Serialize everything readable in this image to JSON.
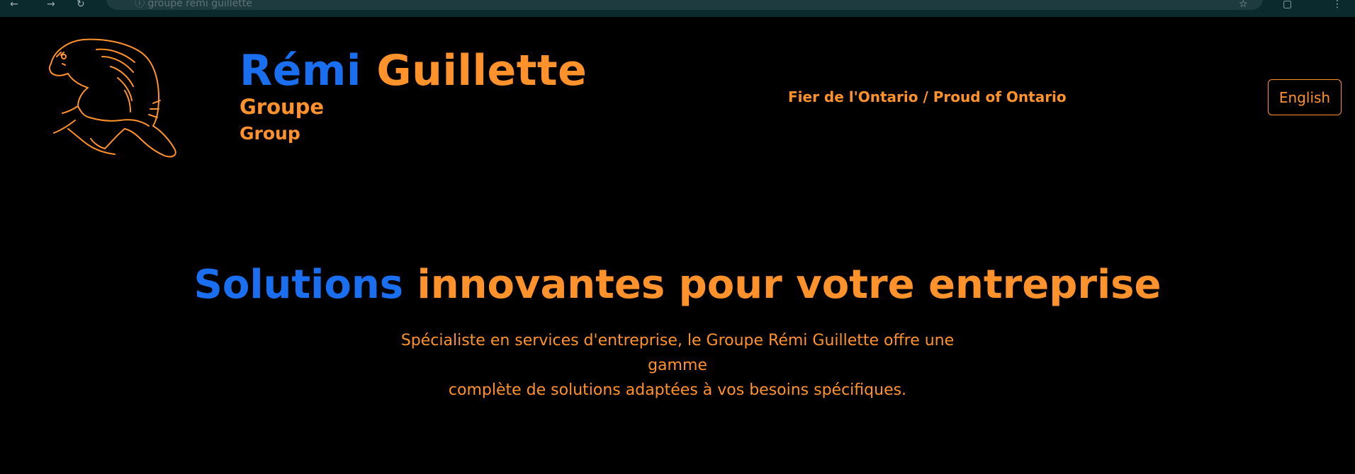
{
  "browser": {
    "url_text": "ⓘ groupe remi guillette"
  },
  "header": {
    "brand_first": "Rémi",
    "brand_last": "Guillette",
    "brand_sub_fr": "Groupe",
    "brand_sub_en": "Group",
    "tagline": "Fier de l'Ontario / Proud of Ontario",
    "language_button": "English"
  },
  "hero": {
    "title_highlight": "Solutions",
    "title_rest": "innovantes pour votre entreprise",
    "description_line1": "Spécialiste en services d'entreprise, le Groupe Rémi Guillette offre une gamme",
    "description_line2": "complète de solutions adaptées à vos besoins spécifiques."
  },
  "colors": {
    "background": "#000000",
    "accent_blue": "#1a6ff0",
    "accent_orange": "#ff922b"
  },
  "icons": [
    "back-icon",
    "forward-icon",
    "reload-icon",
    "bookmark-star-icon",
    "extensions-icon",
    "menu-icon",
    "beaver-logo"
  ]
}
